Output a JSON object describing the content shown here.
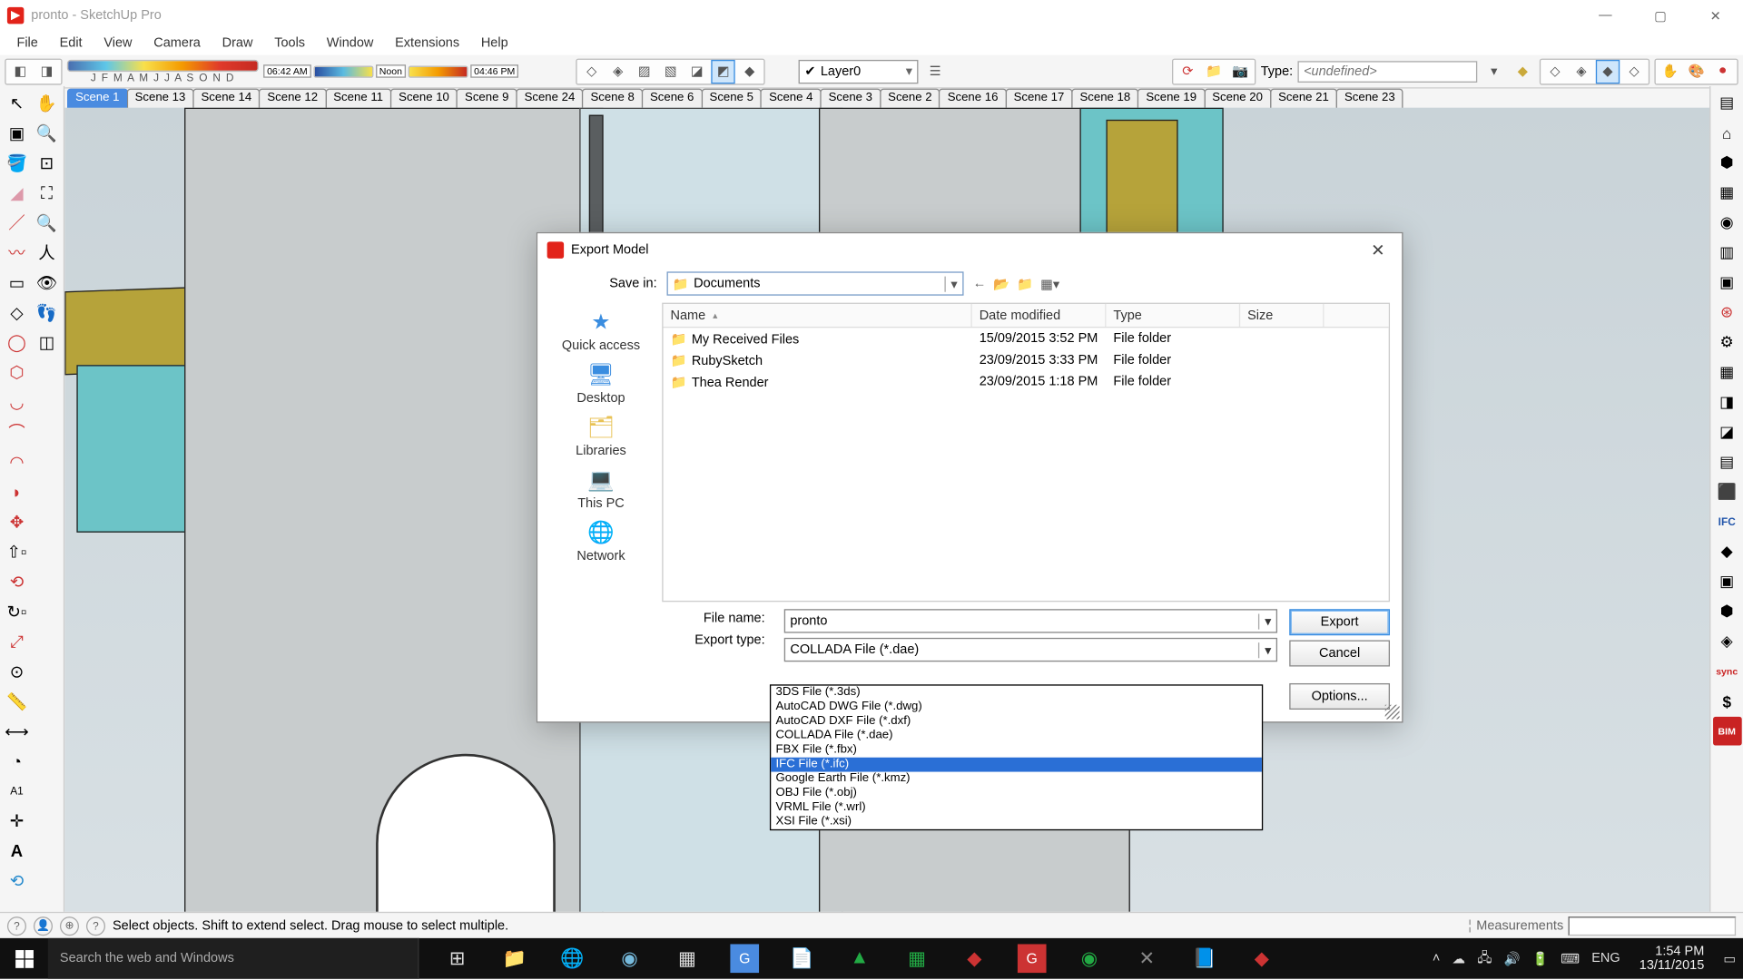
{
  "window": {
    "title": "pronto - SketchUp Pro"
  },
  "menus": [
    "File",
    "Edit",
    "View",
    "Camera",
    "Draw",
    "Tools",
    "Window",
    "Extensions",
    "Help"
  ],
  "shadow": {
    "months": "J F M A M J J A S O N D",
    "time_start": "06:42 AM",
    "noon": "Noon",
    "time_end": "04:46 PM"
  },
  "layer": {
    "current": "Layer0"
  },
  "classifier": {
    "label": "Type:",
    "placeholder": "<undefined>"
  },
  "scenes": [
    "Scene 1",
    "Scene 13",
    "Scene 14",
    "Scene 12",
    "Scene 11",
    "Scene 10",
    "Scene 9",
    "Scene 24",
    "Scene 8",
    "Scene 6",
    "Scene 5",
    "Scene 4",
    "Scene 3",
    "Scene 2",
    "Scene 16",
    "Scene 17",
    "Scene 18",
    "Scene 19",
    "Scene 20",
    "Scene 21",
    "Scene 23"
  ],
  "active_scene": 0,
  "dialog": {
    "title": "Export Model",
    "save_in_label": "Save in:",
    "save_in_value": "Documents",
    "places": [
      "Quick access",
      "Desktop",
      "Libraries",
      "This PC",
      "Network"
    ],
    "columns": [
      "Name",
      "Date modified",
      "Type",
      "Size"
    ],
    "rows": [
      {
        "name": "My Received Files",
        "date": "15/09/2015 3:52 PM",
        "type": "File folder",
        "size": ""
      },
      {
        "name": "RubySketch",
        "date": "23/09/2015 3:33 PM",
        "type": "File folder",
        "size": ""
      },
      {
        "name": "Thea Render",
        "date": "23/09/2015 1:18 PM",
        "type": "File folder",
        "size": ""
      }
    ],
    "file_name_label": "File name:",
    "file_name_value": "pronto",
    "export_type_label": "Export type:",
    "export_type_value": "COLLADA File (*.dae)",
    "export_btn": "Export",
    "cancel_btn": "Cancel",
    "options_btn": "Options..."
  },
  "export_types": [
    "3DS File (*.3ds)",
    "AutoCAD DWG File (*.dwg)",
    "AutoCAD DXF File (*.dxf)",
    "COLLADA File (*.dae)",
    "FBX File (*.fbx)",
    "IFC File (*.ifc)",
    "Google Earth File (*.kmz)",
    "OBJ File (*.obj)",
    "VRML File (*.wrl)",
    "XSI File (*.xsi)"
  ],
  "export_types_selected": 5,
  "status": {
    "hint": "Select objects. Shift to extend select. Drag mouse to select multiple.",
    "measurements_label": "Measurements"
  },
  "taskbar": {
    "search_placeholder": "Search the web and Windows",
    "lang": "ENG",
    "time": "1:54 PM",
    "date": "13/11/2015"
  },
  "right_icons_text": {
    "sync": "sync",
    "bim": "BIM"
  }
}
